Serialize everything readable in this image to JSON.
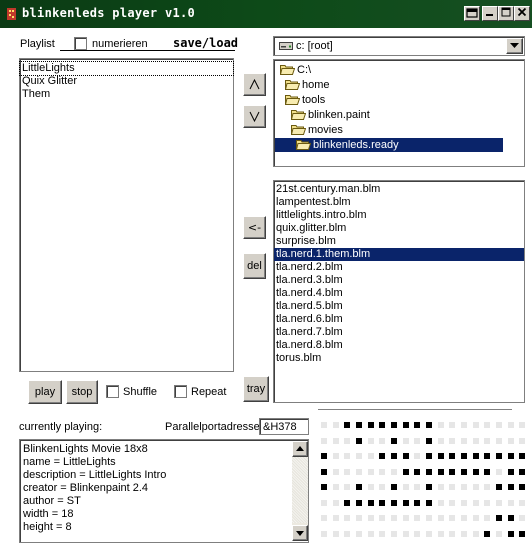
{
  "window": {
    "title": "blinkenleds player v1.0",
    "title_bar_color": "#0d4a18",
    "icons": [
      "app-icon",
      "pin-icon",
      "minimize-icon",
      "maximize-icon",
      "close-icon"
    ]
  },
  "playlist": {
    "label": "Playlist",
    "numerieren_label": "numerieren",
    "save_load_label": "save/load",
    "items": [
      "LittleLights",
      "Quix Glitter",
      "Them"
    ],
    "selected_index": 0
  },
  "move_buttons": {
    "up": "Λ",
    "down": "V",
    "add": "<-",
    "del": "del"
  },
  "drive": {
    "selected": "c: [root]",
    "icon": "drive-icon"
  },
  "folders": [
    {
      "name": "C:\\",
      "depth": 0,
      "open": true
    },
    {
      "name": "home",
      "depth": 1,
      "open": true
    },
    {
      "name": "tools",
      "depth": 1,
      "open": true
    },
    {
      "name": "blinken.paint",
      "depth": 2,
      "open": true
    },
    {
      "name": "movies",
      "depth": 2,
      "open": true
    },
    {
      "name": "blinkenleds.ready",
      "depth": 3,
      "open": true,
      "selected": true
    }
  ],
  "files": [
    "21st.century.man.blm",
    "lampentest.blm",
    "littlelights.intro.blm",
    "quix.glitter.blm",
    "surprise.blm",
    "tla.nerd.1.them.blm",
    "tla.nerd.2.blm",
    "tla.nerd.3.blm",
    "tla.nerd.4.blm",
    "tla.nerd.5.blm",
    "tla.nerd.6.blm",
    "tla.nerd.7.blm",
    "tla.nerd.8.blm",
    "torus.blm"
  ],
  "files_selected_index": 5,
  "controls": {
    "play": "play",
    "stop": "stop",
    "shuffle": "Shuffle",
    "repeat": "Repeat",
    "tray": "tray"
  },
  "status": {
    "currently_playing_label": "currently playing:",
    "port_label": "Parallelportadresse:",
    "port_value": "&H378"
  },
  "info_lines": [
    "BlinkenLights Movie 18x8",
    "name = LittleLights",
    "description = LittleLights Intro",
    "creator = Blinkenpaint 2.4",
    "author = ST",
    "width = 18",
    "height = 8"
  ],
  "led_matrix": {
    "cols": 18,
    "rows": 8,
    "on_color": "#000000",
    "off_color": "#e6e6e6",
    "frame": [
      "001111111100000000",
      "000100100100000000",
      "100001110111111111",
      "100000011111111011",
      "100100100100000111",
      "001111111100000000",
      "000000000000000110",
      "000000000000001011"
    ]
  }
}
